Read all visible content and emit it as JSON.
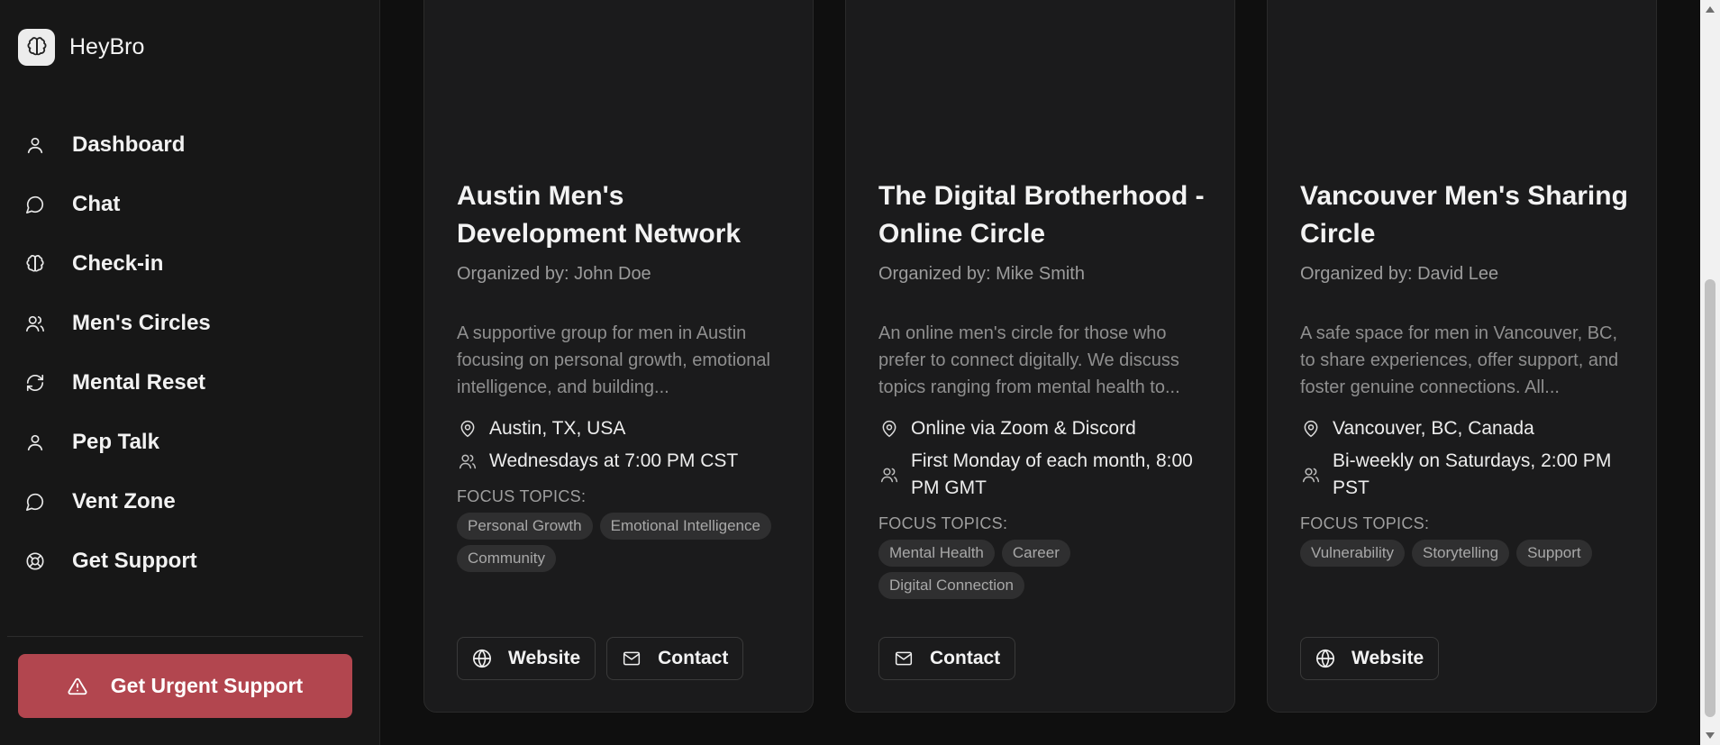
{
  "app": {
    "name": "HeyBro"
  },
  "sidebar": {
    "items": [
      {
        "label": "Dashboard",
        "icon": "user-icon"
      },
      {
        "label": "Chat",
        "icon": "chat-bubble-icon"
      },
      {
        "label": "Check-in",
        "icon": "brain-icon"
      },
      {
        "label": "Men's Circles",
        "icon": "users-icon"
      },
      {
        "label": "Mental Reset",
        "icon": "refresh-icon"
      },
      {
        "label": "Pep Talk",
        "icon": "user-icon"
      },
      {
        "label": "Vent Zone",
        "icon": "chat-bubble-icon"
      },
      {
        "label": "Get Support",
        "icon": "lifebuoy-icon"
      }
    ],
    "urgent": {
      "label": "Get Urgent Support",
      "icon": "warning-icon",
      "color": "#b2464f"
    }
  },
  "circles": [
    {
      "title": "Austin Men's Development Network",
      "organizer": "Organized by: John Doe",
      "description": "A supportive group for men in Austin focusing on personal growth, emotional intelligence, and building...",
      "location": "Austin, TX, USA",
      "schedule": "Wednesdays at 7:00 PM CST",
      "topics_label": "FOCUS TOPICS:",
      "topics": [
        "Personal Growth",
        "Emotional Intelligence",
        "Community"
      ],
      "website_label": "Website",
      "contact_label": "Contact"
    },
    {
      "title": "The Digital Brotherhood - Online Circle",
      "organizer": "Organized by: Mike Smith",
      "description": "An online men's circle for those who prefer to connect digitally. We discuss topics ranging from mental health to...",
      "location": "Online via Zoom & Discord",
      "schedule": "First Monday of each month, 8:00 PM GMT",
      "topics_label": "FOCUS TOPICS:",
      "topics": [
        "Mental Health",
        "Career",
        "Digital Connection"
      ],
      "contact_label": "Contact"
    },
    {
      "title": "Vancouver Men's Sharing Circle",
      "organizer": "Organized by: David Lee",
      "description": "A safe space for men in Vancouver, BC, to share experiences, offer support, and foster genuine connections. All...",
      "location": "Vancouver, BC, Canada",
      "schedule": "Bi-weekly on Saturdays, 2:00 PM PST",
      "topics_label": "FOCUS TOPICS:",
      "topics": [
        "Vulnerability",
        "Storytelling",
        "Support"
      ],
      "website_label": "Website"
    }
  ],
  "icons": {
    "location": "map-pin-icon",
    "schedule": "users-icon",
    "website": "globe-icon",
    "contact": "mail-icon"
  }
}
